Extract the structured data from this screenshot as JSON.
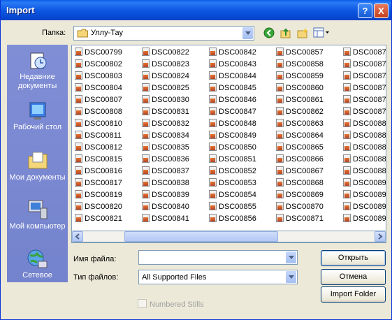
{
  "window": {
    "title": "Import",
    "help_btn": "?",
    "close_btn": "X"
  },
  "toolbar": {
    "folder_label": "Папка:",
    "folder_value": "Уллу-Тау"
  },
  "places": [
    {
      "label": "Недавние документы"
    },
    {
      "label": "Рабочий стол"
    },
    {
      "label": "Мои документы"
    },
    {
      "label": "Мой компьютер"
    },
    {
      "label": "Сетевое"
    }
  ],
  "files": {
    "columns": [
      [
        "DSC00799",
        "DSC00802",
        "DSC00803",
        "DSC00804",
        "DSC00807",
        "DSC00808",
        "DSC00810",
        "DSC00811",
        "DSC00812",
        "DSC00815",
        "DSC00816",
        "DSC00817",
        "DSC00819",
        "DSC00820",
        "DSC00821"
      ],
      [
        "DSC00822",
        "DSC00823",
        "DSC00824",
        "DSC00825",
        "DSC00830",
        "DSC00831",
        "DSC00832",
        "DSC00834",
        "DSC00835",
        "DSC00836",
        "DSC00837",
        "DSC00838",
        "DSC00839",
        "DSC00840",
        "DSC00841"
      ],
      [
        "DSC00842",
        "DSC00843",
        "DSC00844",
        "DSC00845",
        "DSC00846",
        "DSC00847",
        "DSC00848",
        "DSC00849",
        "DSC00850",
        "DSC00851",
        "DSC00852",
        "DSC00853",
        "DSC00854",
        "DSC00855",
        "DSC00856"
      ],
      [
        "DSC00857",
        "DSC00858",
        "DSC00859",
        "DSC00860",
        "DSC00861",
        "DSC00862",
        "DSC00863",
        "DSC00864",
        "DSC00865",
        "DSC00866",
        "DSC00867",
        "DSC00868",
        "DSC00869",
        "DSC00870",
        "DSC00871"
      ],
      [
        "DSC0087",
        "DSC0087",
        "DSC0087",
        "DSC0087",
        "DSC0087",
        "DSC0087",
        "DSC0088",
        "DSC0088",
        "DSC0088",
        "DSC0088",
        "DSC0088",
        "DSC0089",
        "DSC0089",
        "DSC0089",
        "DSC0089"
      ]
    ]
  },
  "form": {
    "filename_label": "Имя файла:",
    "filename_value": "",
    "filetype_label": "Тип файлов:",
    "filetype_value": "All Supported Files",
    "numbered_stills_label": "Numbered Stills"
  },
  "buttons": {
    "open": "Открыть",
    "cancel": "Отмена",
    "import_folder": "Import Folder"
  },
  "colors": {
    "titlebar": "#0a5ee8",
    "places_bg": "#7b8bd7",
    "dialog_bg": "#ece9d8"
  }
}
